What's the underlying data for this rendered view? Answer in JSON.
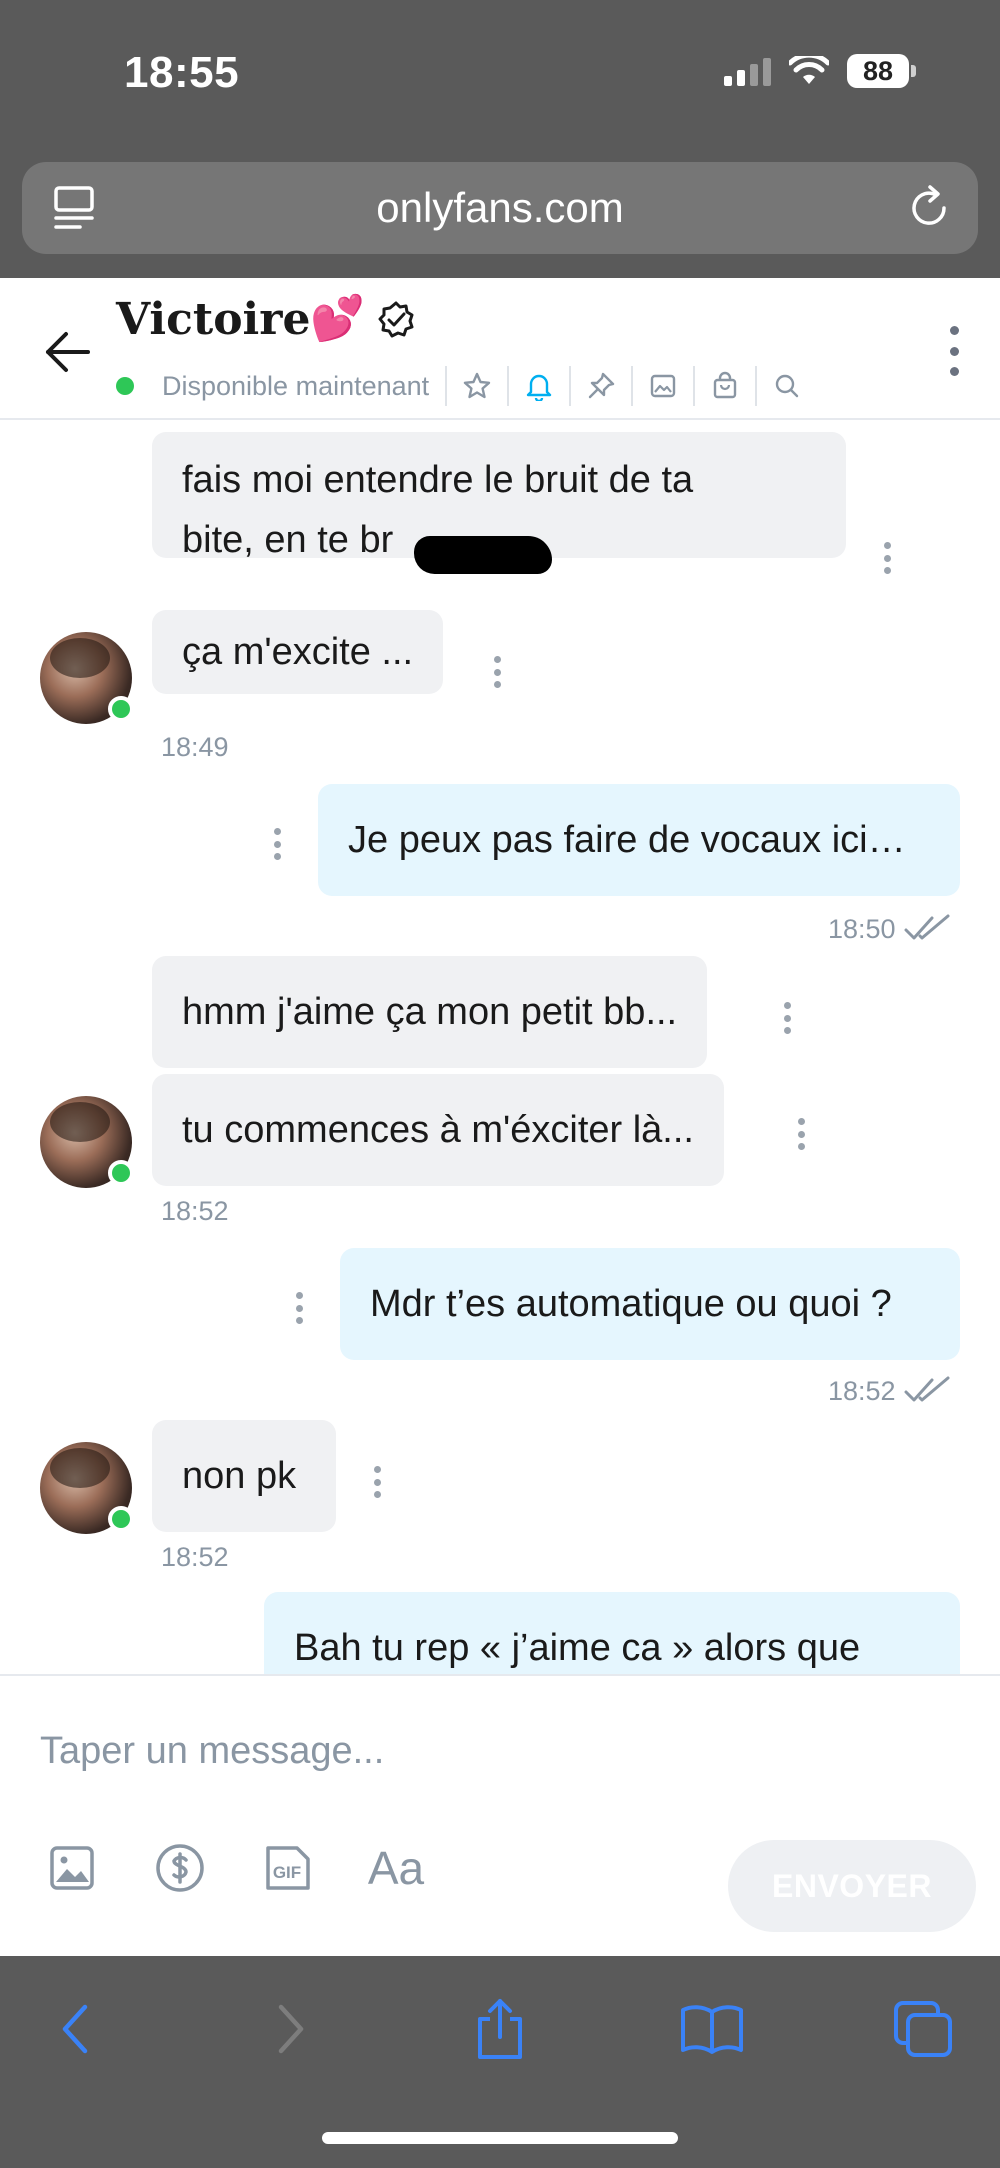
{
  "status_bar": {
    "time": "18:55",
    "battery": "88"
  },
  "browser": {
    "url": "onlyfans.com"
  },
  "chat_header": {
    "name": "Victoire",
    "name_emoji": "💕",
    "status": "Disponible maintenant"
  },
  "messages": [
    {
      "side": "in",
      "text_line1": "fais moi entendre le bruit de ta",
      "text_line2": "bite, en te br",
      "text_tail": "...."
    },
    {
      "side": "in",
      "text": "ça m'excite ..."
    },
    {
      "side": "in",
      "time": "18:49"
    },
    {
      "side": "out",
      "text": "Je peux pas faire de vocaux ici…",
      "time": "18:50"
    },
    {
      "side": "in",
      "text": "hmm j'aime ça mon petit bb..."
    },
    {
      "side": "in",
      "text": "tu commences à m'éxciter là..."
    },
    {
      "side": "in",
      "time": "18:52"
    },
    {
      "side": "out",
      "text": "Mdr t’es automatique ou quoi ?",
      "time": "18:52"
    },
    {
      "side": "in",
      "text": "non pk",
      "time": "18:52"
    },
    {
      "side": "out",
      "text": "Bah tu rep « j’aime ca » alors que"
    }
  ],
  "composer": {
    "placeholder": "Taper un message...",
    "font_button": "Aa",
    "send_label": "ENVOYER"
  },
  "colors": {
    "online": "#2ec757",
    "accent": "#00aff0",
    "bubble_in": "#f0f1f3",
    "bubble_out": "#e5f6fe",
    "chrome": "#5a5a5a",
    "safari_blue": "#3a82f7"
  }
}
